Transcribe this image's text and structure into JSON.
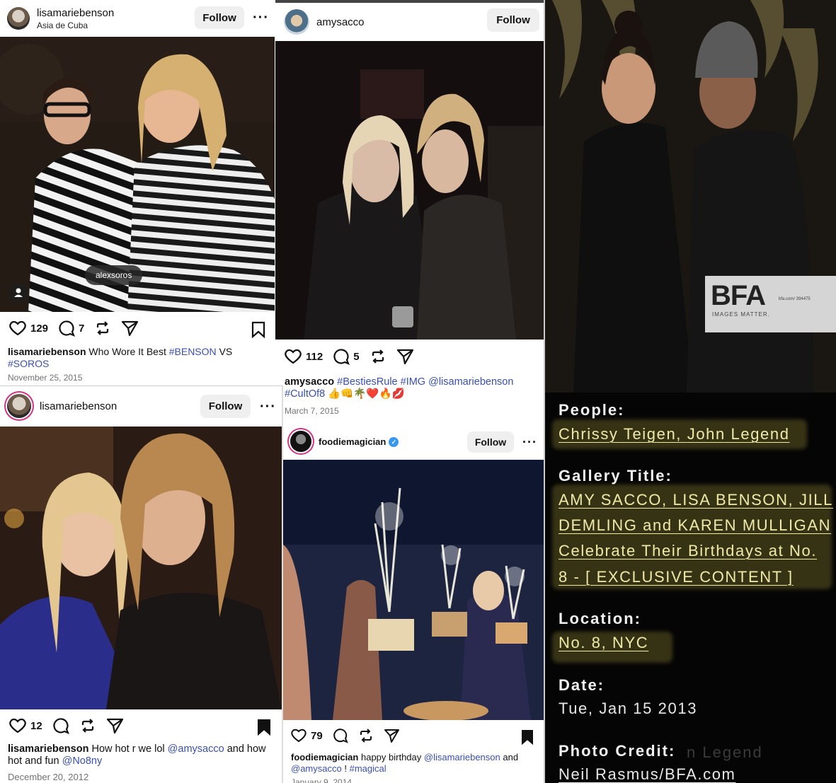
{
  "post1": {
    "username": "lisamariebenson",
    "location": "Asia de Cuba",
    "follow_label": "Follow",
    "photo_tag": "alexsoros",
    "likes": "129",
    "comments": "7",
    "caption_user": "lisamariebenson",
    "caption_text": "Who Wore It Best",
    "caption_tag1": "#BENSON",
    "caption_vs": "VS",
    "caption_tag2": "#SOROS",
    "date": "November 25, 2015"
  },
  "post2": {
    "username": "amysacco",
    "follow_label": "Follow",
    "likes": "112",
    "comments": "5",
    "caption_user": "amysacco",
    "caption_tags": "#BestiesRule #IMG @lisamariebenson",
    "caption_tag2": "#CultOf8",
    "caption_emoji": "👍👊🌴❤️🔥💋",
    "date": "March 7, 2015"
  },
  "post3": {
    "username": "lisamariebenson",
    "follow_label": "Follow",
    "likes": "12",
    "caption_user": "lisamariebenson",
    "caption_text1": "How hot r we lol",
    "caption_mention1": "@amysacco",
    "caption_text2": "and how",
    "caption_text3": "hot and fun",
    "caption_mention2": "@No8ny",
    "date": "December 20, 2012"
  },
  "post4": {
    "username": "foodiemagician",
    "follow_label": "Follow",
    "likes": "79",
    "caption_user": "foodiemagician",
    "caption_text": "happy birthday",
    "caption_mention1": "@lisamariebenson",
    "caption_and": "and",
    "caption_mention2": "@amysacco",
    "caption_bang": "!",
    "caption_tag": "#magical",
    "date": "January 9, 2014"
  },
  "bfa": {
    "logo": "BFA",
    "logo_tag": "IMAGES MATTER.",
    "logo_small": "bfa.com/ 394475",
    "people_label": "People:",
    "people_1": "Chrissy Teigen",
    "people_sep": ", ",
    "people_2": "John Legend",
    "gallery_label": "Gallery Title:",
    "gallery_line1": "AMY SACCO, LISA BENSON, JILL",
    "gallery_line2": "DEMLING and KAREN MULLIGAN",
    "gallery_line3": "Celebrate Their Birthdays at No.",
    "gallery_line4": "8 - [ EXCLUSIVE CONTENT ]",
    "location_label": "Location:",
    "location_value": "No. 8, NYC",
    "date_label": "Date:",
    "date_value": "Tue, Jan 15 2013",
    "credit_label": "Photo Credit:",
    "credit_value": "Neil Rasmus/BFA.com",
    "ghost_text": "n Legend"
  }
}
